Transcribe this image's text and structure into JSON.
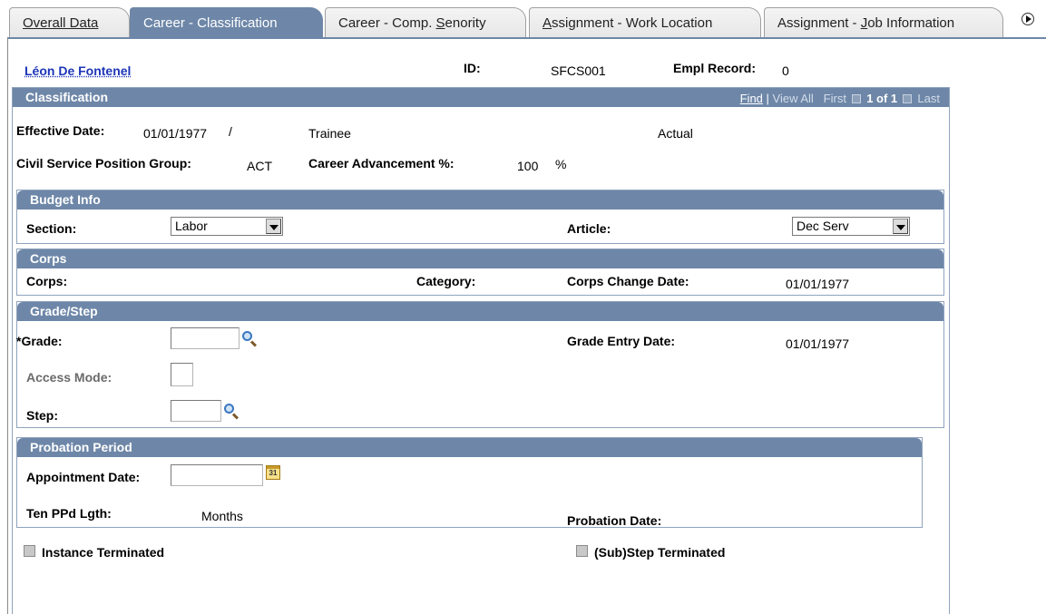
{
  "tabs": [
    {
      "label": "Overall Data"
    },
    {
      "label": "Career - Classification"
    },
    {
      "pre": "Career - Comp. ",
      "u": "S",
      "post": "enority"
    },
    {
      "pre": "",
      "u": "A",
      "post": "ssignment - Work Location"
    },
    {
      "pre": "Assignment - ",
      "u": "J",
      "post": "ob Information"
    }
  ],
  "header": {
    "employee_name": "Léon De Fontenel",
    "id_label": "ID:",
    "id_value": "SFCS001",
    "empl_record_label": "Empl Record:",
    "empl_record_value": "0"
  },
  "classification": {
    "title": "Classification",
    "nav": {
      "find": "Find",
      "view_all": "View All",
      "first": "First",
      "position": "1 of 1",
      "last": "Last"
    },
    "effective_date_label": "Effective Date:",
    "effective_date_value": "01/01/1977",
    "slash": "/",
    "status": "Trainee",
    "actual": "Actual",
    "civil_service_label": "Civil Service Position Group:",
    "civil_service_value": "ACT",
    "career_adv_label": "Career Advancement %:",
    "career_adv_value": "100",
    "percent": "%"
  },
  "budget": {
    "title": "Budget Info",
    "section_label": "Section:",
    "section_value": "Labor",
    "article_label": "Article:",
    "article_value": "Dec Serv"
  },
  "corps": {
    "title": "Corps",
    "corps_label": "Corps:",
    "category_label": "Category:",
    "change_date_label": "Corps Change Date:",
    "change_date_value": "01/01/1977"
  },
  "grade": {
    "title": "Grade/Step",
    "grade_label": "*Grade:",
    "access_mode_label": "Access Mode:",
    "step_label": "Step:",
    "entry_date_label": "Grade Entry Date:",
    "entry_date_value": "01/01/1977"
  },
  "probation": {
    "title": "Probation Period",
    "appointment_label": "Appointment Date:",
    "ten_ppd_label": "Ten PPd Lgth:",
    "months": "Months",
    "probation_date_label": "Probation Date:",
    "calendar_text": "31"
  },
  "footer": {
    "instance_terminated": "Instance Terminated",
    "substep_terminated": "(Sub)Step Terminated"
  }
}
